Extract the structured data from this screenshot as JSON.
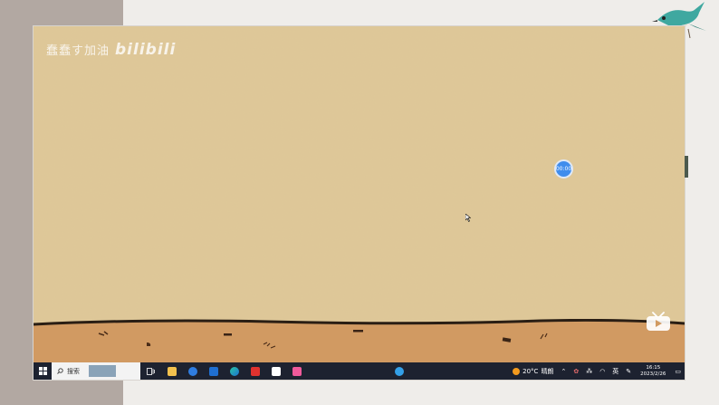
{
  "watermark": {
    "text": "蠢蠢す加油",
    "logo": "bilibili"
  },
  "timer": {
    "label": "00:00"
  },
  "taskbar": {
    "search_placeholder": "搜索",
    "apps": [
      "task-view-icon",
      "file-explorer-icon",
      "app-blue-icon",
      "mail-icon",
      "edge-browser-icon",
      "wps-office-icon",
      "bag-app-icon",
      "pink-app-icon"
    ],
    "weather": {
      "temp": "20°C",
      "condition": "晴朗"
    },
    "ime": "英",
    "time": "16:15",
    "date": "2023/2/26"
  },
  "colors": {
    "paper": "#dfc898",
    "ground": "#d19a62",
    "taskbar": "#1d2230",
    "timer_button": "#3f8ded"
  }
}
